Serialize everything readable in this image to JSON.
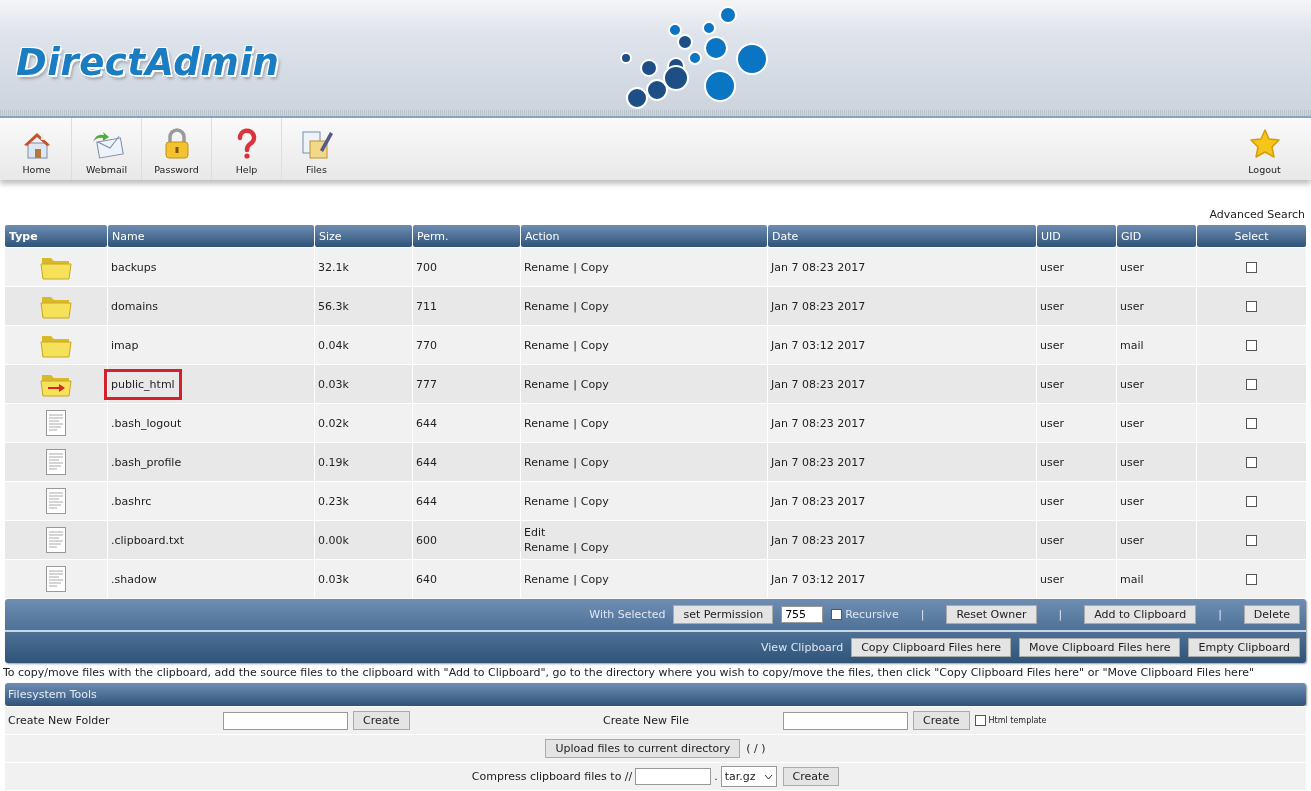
{
  "header": {
    "logo": "DirectAdmin"
  },
  "toolbar": [
    {
      "label": "Home",
      "kind": "home"
    },
    {
      "label": "Webmail",
      "kind": "mail"
    },
    {
      "label": "Password",
      "kind": "lock"
    },
    {
      "label": "Help",
      "kind": "help"
    },
    {
      "label": "Files",
      "kind": "files"
    }
  ],
  "logout": {
    "label": "Logout"
  },
  "advanced_search": "Advanced Search",
  "table": {
    "columns": [
      "Type",
      "Name",
      "Size",
      "Perm.",
      "Action",
      "Date",
      "UID",
      "GID",
      "Select"
    ],
    "rows": [
      {
        "kind": "folder",
        "name": "backups",
        "size": "32.1k",
        "perm": "700",
        "action_lines": [
          [
            "Rename",
            "|",
            "Copy"
          ]
        ],
        "date": "Jan 7 08:23 2017",
        "uid": "user",
        "gid": "user",
        "checked": false,
        "highlighted": false
      },
      {
        "kind": "folder",
        "name": "domains",
        "size": "56.3k",
        "perm": "711",
        "action_lines": [
          [
            "Rename",
            "|",
            "Copy"
          ]
        ],
        "date": "Jan 7 08:23 2017",
        "uid": "user",
        "gid": "user",
        "checked": false,
        "highlighted": false
      },
      {
        "kind": "folder",
        "name": "imap",
        "size": "0.04k",
        "perm": "770",
        "action_lines": [
          [
            "Rename",
            "|",
            "Copy"
          ]
        ],
        "date": "Jan 7 03:12 2017",
        "uid": "user",
        "gid": "mail",
        "checked": false,
        "highlighted": false
      },
      {
        "kind": "link",
        "name": "public_html",
        "size": "0.03k",
        "perm": "777",
        "action_lines": [
          [
            "Rename",
            "|",
            "Copy"
          ]
        ],
        "date": "Jan 7 08:23 2017",
        "uid": "user",
        "gid": "user",
        "checked": false,
        "highlighted": true
      },
      {
        "kind": "file",
        "name": ".bash_logout",
        "size": "0.02k",
        "perm": "644",
        "action_lines": [
          [
            "Rename",
            "|",
            "Copy"
          ]
        ],
        "date": "Jan 7 08:23 2017",
        "uid": "user",
        "gid": "user",
        "checked": false,
        "highlighted": false
      },
      {
        "kind": "file",
        "name": ".bash_profile",
        "size": "0.19k",
        "perm": "644",
        "action_lines": [
          [
            "Rename",
            "|",
            "Copy"
          ]
        ],
        "date": "Jan 7 08:23 2017",
        "uid": "user",
        "gid": "user",
        "checked": false,
        "highlighted": false
      },
      {
        "kind": "file",
        "name": ".bashrc",
        "size": "0.23k",
        "perm": "644",
        "action_lines": [
          [
            "Rename",
            "|",
            "Copy"
          ]
        ],
        "date": "Jan 7 08:23 2017",
        "uid": "user",
        "gid": "user",
        "checked": false,
        "highlighted": false
      },
      {
        "kind": "file",
        "name": ".clipboard.txt",
        "size": "0.00k",
        "perm": "600",
        "action_lines": [
          [
            "Edit"
          ],
          [
            "Rename",
            "|",
            "Copy"
          ]
        ],
        "date": "Jan 7 08:23 2017",
        "uid": "user",
        "gid": "user",
        "checked": false,
        "highlighted": false
      },
      {
        "kind": "file",
        "name": ".shadow",
        "size": "0.03k",
        "perm": "640",
        "action_lines": [
          [
            "Rename",
            "|",
            "Copy"
          ]
        ],
        "date": "Jan 7 03:12 2017",
        "uid": "user",
        "gid": "mail",
        "checked": false,
        "highlighted": false
      }
    ]
  },
  "with_selected": [
    {
      "kind": "label",
      "text": "With Selected"
    },
    {
      "kind": "button",
      "text": "set Permission"
    },
    {
      "kind": "field",
      "value": "755"
    },
    {
      "kind": "checkbox",
      "text": "Recursive",
      "checked": false
    },
    {
      "kind": "sep",
      "text": "|"
    },
    {
      "kind": "button",
      "text": "Reset Owner"
    },
    {
      "kind": "sep",
      "text": "|"
    },
    {
      "kind": "button",
      "text": "Add to Clipboard"
    },
    {
      "kind": "sep",
      "text": "|"
    },
    {
      "kind": "button",
      "text": "Delete"
    }
  ],
  "clipboard_bar": [
    {
      "kind": "label",
      "text": "View Clipboard"
    },
    {
      "kind": "button",
      "text": "Copy Clipboard Files here"
    },
    {
      "kind": "button",
      "text": "Move Clipboard Files here"
    },
    {
      "kind": "button",
      "text": "Empty Clipboard"
    }
  ],
  "instructions": "To copy/move files with the clipboard, add the source files to the clipboard with \"Add to Clipboard\", go to the directory where you wish to copy/move the files, then click \"Copy Clipboard Files here\" or \"Move Clipboard Files here\"",
  "tools": {
    "title": "Filesystem Tools",
    "create_folder": {
      "label": "Create New Folder",
      "button": "Create"
    },
    "create_file": {
      "label": "Create New File",
      "button": "Create",
      "template": {
        "label": "Html template",
        "checked": false
      }
    },
    "upload": {
      "button": "Upload files to current directory",
      "path": "( / )"
    },
    "compress": {
      "label": "Compress clipboard files to //",
      "dot": ".",
      "format": "tar.gz",
      "button": "Create"
    }
  }
}
